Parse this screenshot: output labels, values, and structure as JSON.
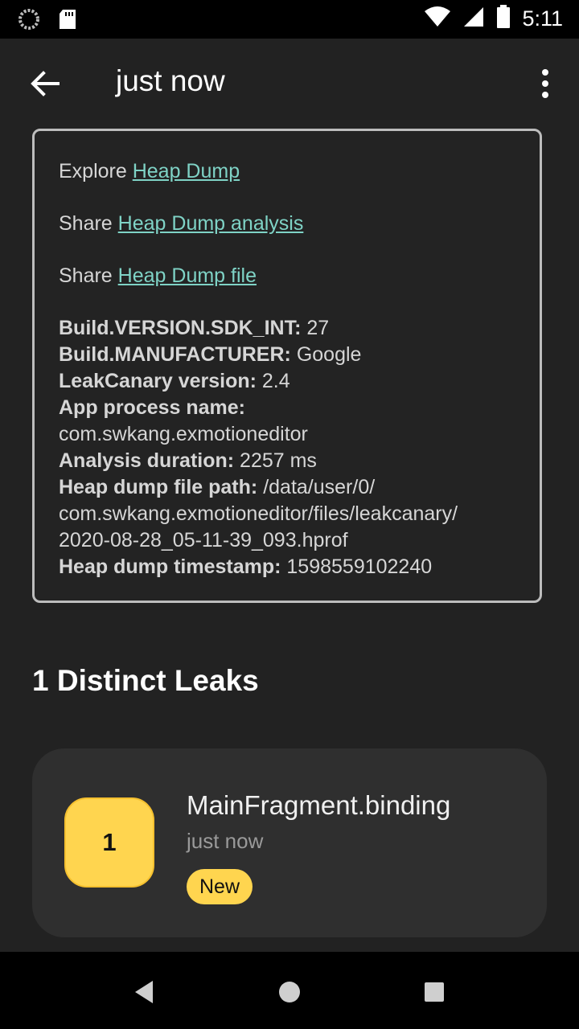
{
  "status_bar": {
    "time": "5:11",
    "left_icons": [
      "loading-icon",
      "sd-card-icon"
    ],
    "right_icons": [
      "wifi-icon",
      "signal-icon",
      "battery-icon"
    ]
  },
  "app_bar": {
    "title": "just now",
    "back_icon": "arrow-back-icon",
    "more_icon": "more-vert-icon"
  },
  "card": {
    "explore_prefix": "Explore",
    "explore_link": "Heap Dump",
    "share_analysis_prefix": "Share",
    "share_analysis_link": "Heap Dump analysis",
    "share_file_prefix": "Share",
    "share_file_link": "Heap Dump file",
    "info": [
      {
        "label": "Build.VERSION.SDK_INT:",
        "value": "27"
      },
      {
        "label": "Build.MANUFACTURER:",
        "value": "Google"
      },
      {
        "label": "LeakCanary version:",
        "value": "2.4"
      },
      {
        "label": "App process name:",
        "value": ""
      },
      {
        "label": "",
        "value": "com.swkang.exmotioneditor"
      },
      {
        "label": "Analysis duration:",
        "value": "2257 ms"
      },
      {
        "label": "Heap dump file path:",
        "value": "/data/user/0/"
      },
      {
        "label": "",
        "value": "com.swkang.exmotioneditor/files/leakcanary/"
      },
      {
        "label": "",
        "value": "2020-08-28_05-11-39_093.hprof"
      },
      {
        "label": "Heap dump timestamp:",
        "value": "1598559102240"
      }
    ],
    "link_color": "#7fd3c6"
  },
  "section": {
    "title": "1 Distinct Leaks"
  },
  "leak": {
    "count": "1",
    "title": "MainFragment.binding",
    "time": "just now",
    "tag": "New",
    "badge_color": "#ffd54f"
  },
  "nav_bar": {
    "icons": [
      "back-triangle-icon",
      "home-circle-icon",
      "recents-square-icon"
    ]
  }
}
